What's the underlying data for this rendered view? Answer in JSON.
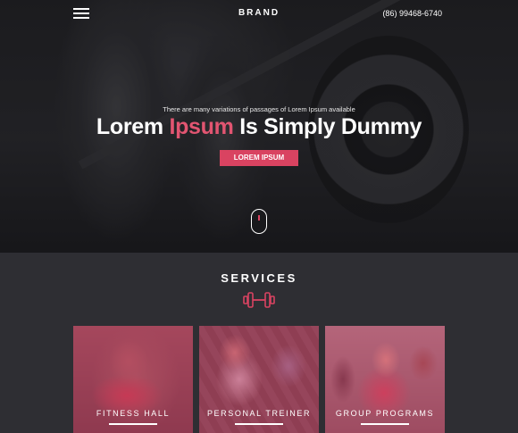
{
  "header": {
    "brand": "BRAND",
    "phone": "(86) 99468-6740",
    "menu_icon": "hamburger-menu-icon"
  },
  "hero": {
    "subtitle": "There are many variations of passages of Lorem Ipsum available",
    "title_part1": "Lorem ",
    "title_accent": "Ipsum",
    "title_part2": " Is Simply Dummy",
    "cta_label": "LOREM IPSUM",
    "scroll_icon": "mouse-scroll-icon"
  },
  "services": {
    "title": "SERVICES",
    "icon": "dumbbell-icon",
    "cards": [
      {
        "label": "FITNESS HALL"
      },
      {
        "label": "PERSONAL TREINER"
      },
      {
        "label": "GROUP PROGRAMS"
      }
    ]
  },
  "colors": {
    "accent": "#d94361",
    "background": "#2e2e33",
    "text": "#ffffff"
  }
}
